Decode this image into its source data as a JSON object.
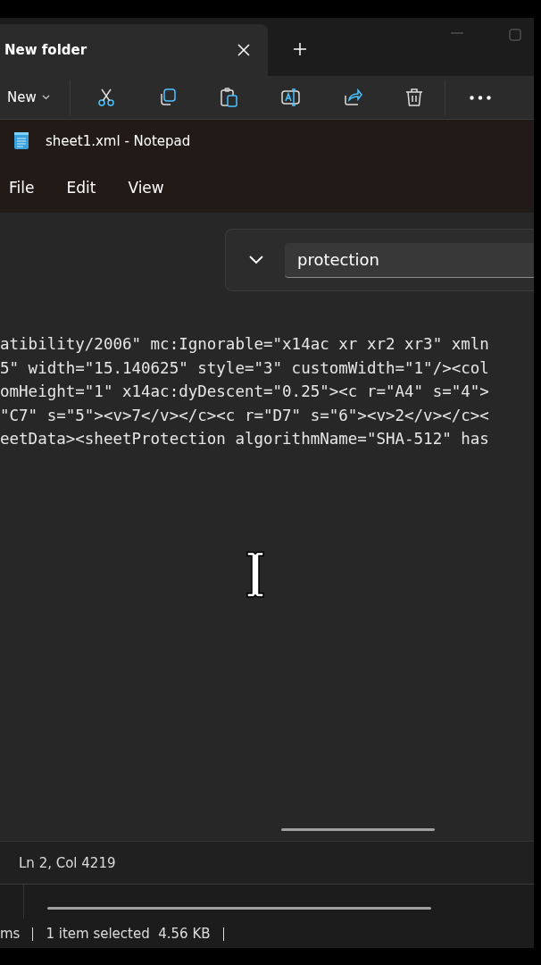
{
  "explorer": {
    "tabs": [
      {
        "label": "New folder",
        "selected": true
      }
    ],
    "toolbar": {
      "new_label": "New"
    }
  },
  "notepad": {
    "title": "sheet1.xml - Notepad",
    "menu": [
      "File",
      "Edit",
      "View"
    ],
    "find": {
      "value": "protection"
    },
    "lines": [
      "atibility/2006\" mc:Ignorable=\"x14ac xr xr2 xr3\" xmln",
      "5\" width=\"15.140625\" style=\"3\" customWidth=\"1\"/><col",
      "omHeight=\"1\" x14ac:dyDescent=\"0.25\"><c r=\"A4\" s=\"4\">",
      "\"C7\" s=\"5\"><v>7</v></c><c r=\"D7\" s=\"6\"><v>2</v></c><",
      "eetData><sheetProtection algorithmName=\"SHA-512\" has"
    ],
    "status_bar": "Ln 2, Col 4219"
  },
  "explorer_status": [
    "ms",
    "1 item selected  4.56 KB"
  ]
}
